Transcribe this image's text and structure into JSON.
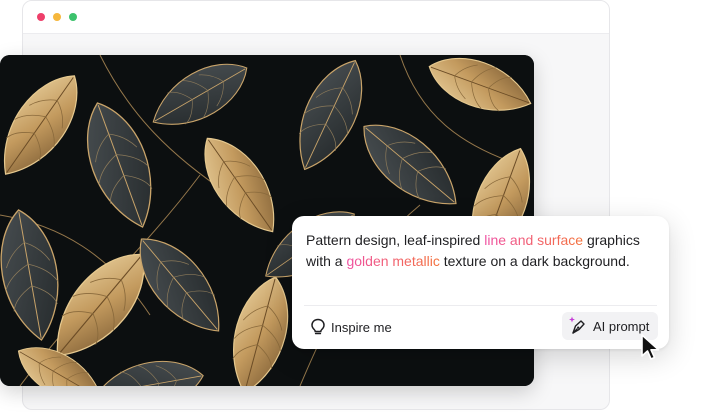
{
  "window_controls": {
    "close_color": "#ee3f6a",
    "minimize_color": "#f6b73c",
    "maximize_color": "#3cc26c"
  },
  "prompt": {
    "segments": [
      {
        "text": "Pattern design, leaf-inspired ",
        "style": "plain"
      },
      {
        "text": "line and surface",
        "style": "pink"
      },
      {
        "text": " graphics with a ",
        "style": "plain"
      },
      {
        "text": "golden metallic",
        "style": "pink"
      },
      {
        "text": " texture on a dark background.",
        "style": "plain"
      }
    ]
  },
  "actions": {
    "inspire_label": "Inspire me",
    "inspire_icon": "lightbulb-icon",
    "ai_label": "AI prompt",
    "ai_icon": "ai-pen-sparkle-icon"
  },
  "image": {
    "subject": "gold-leaf-pattern",
    "background_color": "#0c0f10",
    "leaf_gold": "#c9a46a",
    "leaf_gray": "#3a3f42"
  },
  "colors": {
    "highlight_pink": "#ef4fa3",
    "highlight_orange": "#f4713a"
  }
}
